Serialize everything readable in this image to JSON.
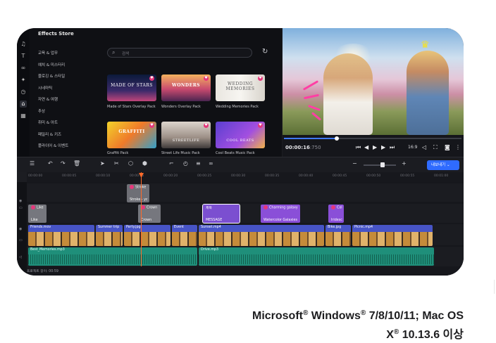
{
  "store": {
    "title": "Effects Store",
    "search_placeholder": "검색",
    "categories": [
      "교육 & 업무",
      "예치 & 미스터리",
      "블로깅 & 스타일",
      "시네마틱",
      "자연 & 여행",
      "추상",
      "취미 & 아트",
      "패밀리 & 키즈",
      "플라이어 & 이벤트"
    ],
    "cards": [
      {
        "thumb": "MADE OF STARS",
        "caption": "Made of Stars Overlay Pack"
      },
      {
        "thumb": "WONDERS",
        "caption": "Wonders Overlay Pack"
      },
      {
        "thumb": "WEDDING MEMORIES",
        "caption": "Wedding Memories Pack"
      },
      {
        "thumb": "GRAFFITI",
        "caption": "Graffiti Pack"
      },
      {
        "thumb": "STREETLIFE",
        "caption": "Street Life Music Pack"
      },
      {
        "thumb": "COOL BEATS",
        "caption": "Cool Beats Music Pack"
      }
    ]
  },
  "player": {
    "time_current": "00:00:16",
    "time_frac": ":750",
    "ratio": "16:9",
    "progress_fraction": 0.3
  },
  "toolbar": {
    "export_label": "내보내기"
  },
  "ruler": [
    "00:00:00",
    "00:00:05",
    "00:00:10",
    "00:00:15",
    "00:00:20",
    "00:00:25",
    "00:00:30",
    "00:00:35",
    "00:00:40",
    "00:00:45",
    "00:00:50",
    "00:00:55",
    "00:01:00",
    "00:01:05"
  ],
  "timeline": {
    "fx_clips": [
      {
        "label": "Stroke",
        "sub": "Stroke - yc"
      },
      {
        "label": "Like",
        "sub": "Like"
      },
      {
        "label": "Crown",
        "sub": "Crown"
      },
      {
        "label": "제목",
        "sub": "MESSAGE"
      },
      {
        "label": "Charming galaxy",
        "sub": "Watercolor Galaxies"
      },
      {
        "label": "Col",
        "sub": "Iridesc"
      }
    ],
    "video_clips": [
      "Friends.mov",
      "Summer trip",
      "Party.jpg",
      "Event",
      "Sunset.mp4",
      "Bike.jpg",
      "Picnic.mp4"
    ],
    "audio_clips": [
      "Best_Memories.mp3",
      "Drive.mp3"
    ],
    "status": "프로젝트 길이: 00:59"
  },
  "caption": {
    "line1_a": "Microsoft",
    "reg": "®",
    "line1_b": " Windows",
    "line1_c": " 7/8/10/11; Mac OS",
    "line2_a": "X",
    "line2_b": " 10.13.6 이상"
  },
  "colors": {
    "accent": "#2f6bff",
    "playhead": "#ff6a2a",
    "audio": "#1f8f7a",
    "video": "#4754c6",
    "fx": "#8a4fd8"
  }
}
